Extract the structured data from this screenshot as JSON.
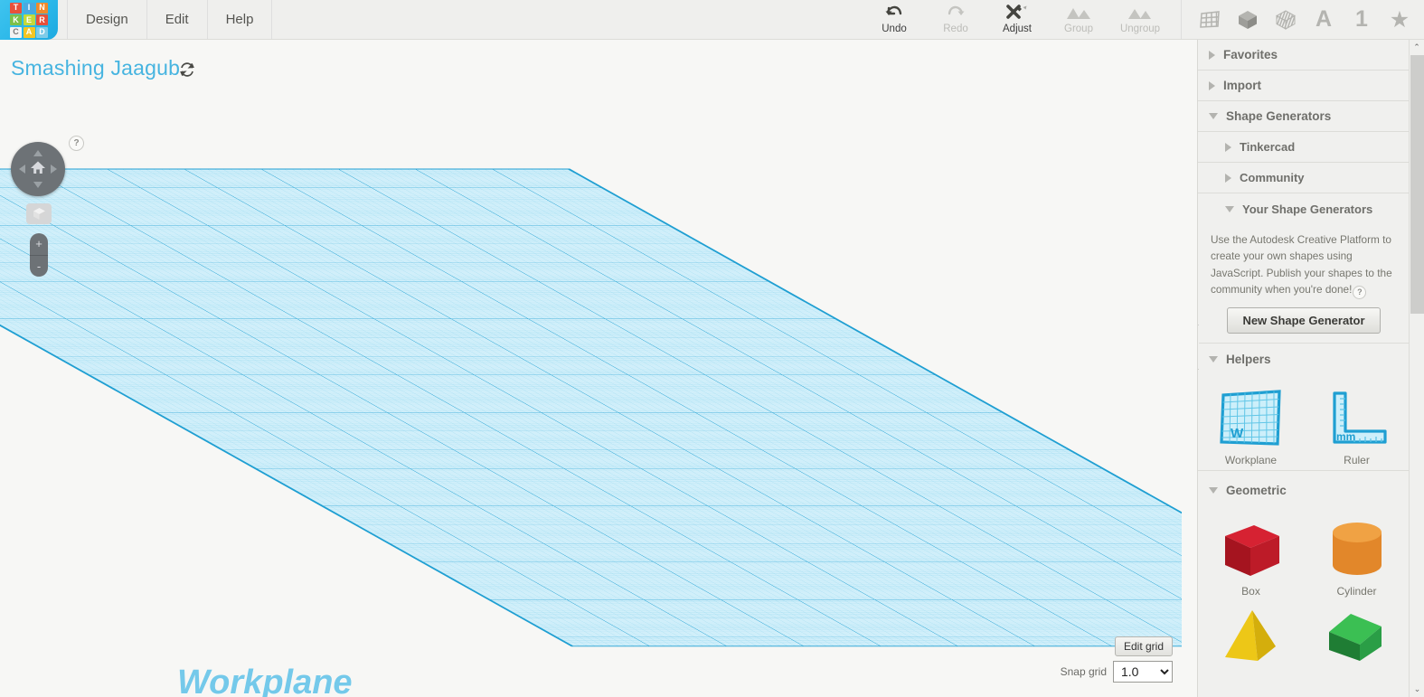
{
  "logo": {
    "name": "tinkercad-logo",
    "letters": [
      {
        "ch": "T",
        "color": "#e8503a"
      },
      {
        "ch": "I",
        "color": "#4aa8e0"
      },
      {
        "ch": "N",
        "color": "#f08a2c"
      },
      {
        "ch": "K",
        "color": "#7cc04a"
      },
      {
        "ch": "E",
        "color": "#c3d93a"
      },
      {
        "ch": "R",
        "color": "#e8503a"
      },
      {
        "ch": "C",
        "color": "#f2f2f2"
      },
      {
        "ch": "A",
        "color": "#f3c623"
      },
      {
        "ch": "D",
        "color": "#7ecbe8"
      }
    ]
  },
  "menu": {
    "items": [
      {
        "label": "Design"
      },
      {
        "label": "Edit"
      },
      {
        "label": "Help"
      }
    ]
  },
  "toolbar": {
    "buttons": [
      {
        "label": "Undo",
        "icon": "undo-icon",
        "enabled": true
      },
      {
        "label": "Redo",
        "icon": "redo-icon",
        "enabled": false
      },
      {
        "label": "Adjust",
        "icon": "adjust-icon",
        "enabled": true
      },
      {
        "label": "Group",
        "icon": "group-icon",
        "enabled": false
      },
      {
        "label": "Ungroup",
        "icon": "ungroup-icon",
        "enabled": false
      }
    ],
    "right_icons": [
      {
        "name": "workplane-grid-icon"
      },
      {
        "name": "solid-cube-icon"
      },
      {
        "name": "hole-cube-icon"
      },
      {
        "name": "text-letter-icon",
        "glyph": "A"
      },
      {
        "name": "number-icon",
        "glyph": "1"
      },
      {
        "name": "star-favorites-icon",
        "glyph": "★"
      }
    ]
  },
  "canvas": {
    "project_title": "Smashing Jaagub",
    "sync_icon": "refresh-sync-icon",
    "help_badge": "?",
    "workplane_label": "Workplane",
    "nav": {
      "home_icon": "home-icon",
      "fit_view_icon": "fit-to-view-cube-icon",
      "zoom_in": "+",
      "zoom_out": "-"
    },
    "grid_controls": {
      "edit_grid_label": "Edit grid",
      "snap_grid_label": "Snap grid",
      "snap_grid_value": "1.0",
      "snap_grid_options": [
        "1.0"
      ]
    }
  },
  "panel": {
    "collapse_icon": "❯",
    "sections": [
      {
        "label": "Favorites",
        "open": false,
        "sub": false
      },
      {
        "label": "Import",
        "open": false,
        "sub": false
      },
      {
        "label": "Shape Generators",
        "open": true,
        "sub": false
      },
      {
        "label": "Tinkercad",
        "open": false,
        "sub": true
      },
      {
        "label": "Community",
        "open": false,
        "sub": true
      },
      {
        "label": "Your Shape Generators",
        "open": true,
        "sub": true
      }
    ],
    "generator_description": "Use the Autodesk Creative Platform to create your own shapes using JavaScript. Publish your shapes to the community when you're done!",
    "generator_help_badge": "?",
    "new_shape_generator_label": "New Shape Generator",
    "helpers": {
      "label": "Helpers",
      "open": true,
      "shapes": [
        {
          "name": "Workplane",
          "icon": "workplane-helper-icon",
          "badge": "W"
        },
        {
          "name": "Ruler",
          "icon": "ruler-helper-icon",
          "badge": "mm"
        }
      ]
    },
    "geometric": {
      "label": "Geometric",
      "open": true,
      "shapes": [
        {
          "name": "Box",
          "icon": "box-shape-icon",
          "color": "#c8202e"
        },
        {
          "name": "Cylinder",
          "icon": "cylinder-shape-icon",
          "color": "#e08323"
        },
        {
          "name": "",
          "icon": "pyramid-shape-icon",
          "color": "#e8c615"
        },
        {
          "name": "",
          "icon": "roof-shape-icon",
          "color": "#2a9e46"
        }
      ]
    },
    "scrollbar": {
      "up": "⌃",
      "down": "⌄"
    }
  },
  "colors": {
    "accent_blue": "#46b4e0",
    "workplane_fill": "#d3f0fa",
    "workplane_line": "#2ea8d8",
    "panel_bg": "#f0f0ee",
    "topbar_bg": "#efefed"
  }
}
